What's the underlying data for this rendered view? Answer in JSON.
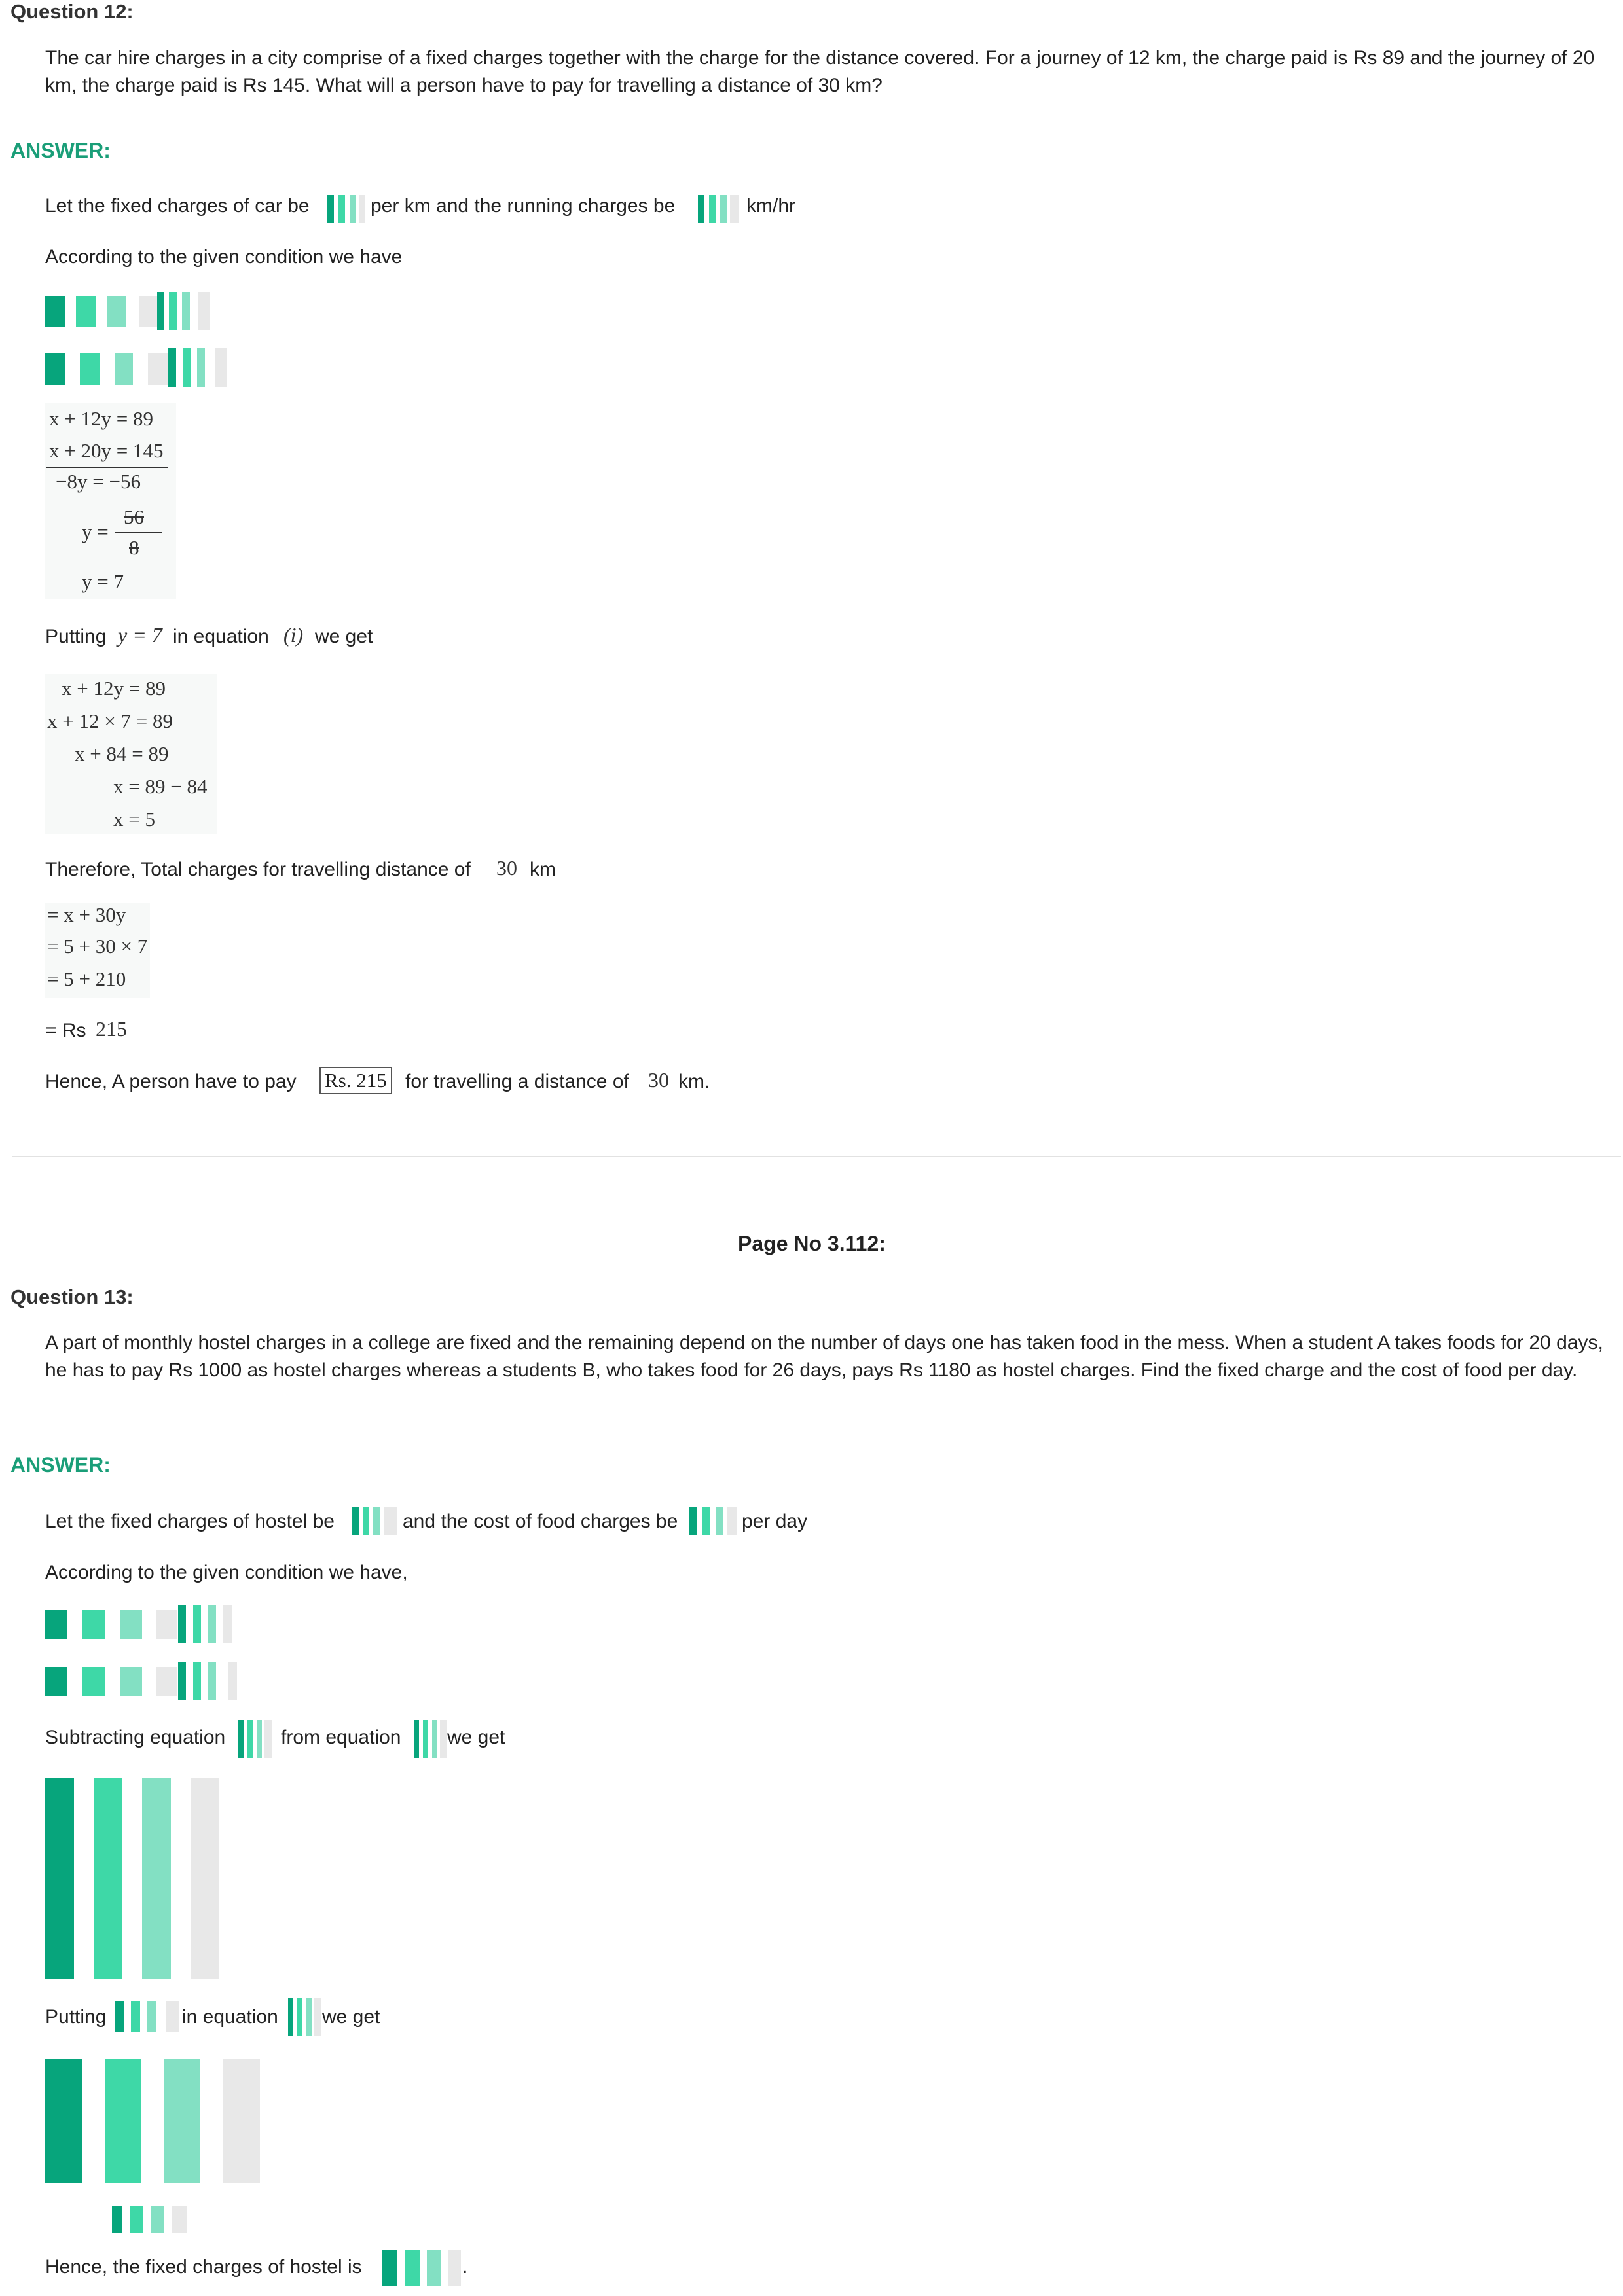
{
  "q12": {
    "title": "Question 12:",
    "text": "The car hire charges in a city comprise of a fixed charges together with the charge for the distance covered. For a journey of 12 km, the charge paid is Rs 89 and the journey of 20 km, the charge paid is Rs 145. What will a person have to pay for travelling a distance of 30 km?",
    "answer_label": "ANSWER:",
    "let_a": "Let the fixed charges of car be",
    "let_b": "per km and the running charges be",
    "let_c": "km/hr",
    "condition": "According to the given condition we have",
    "elim": [
      "x + 12y = 89",
      "x + 20y = 145",
      "−8y = −56",
      "y = ",
      "56",
      "8",
      "y = 7"
    ],
    "putting_a": "Putting",
    "putting_math": "y = 7",
    "putting_b": "in equation",
    "putting_eq": "(i)",
    "putting_c": "we get",
    "solve": [
      "x + 12y = 89",
      "x + 12 × 7 = 89",
      "x + 84 = 89",
      "x = 89 − 84",
      "x = 5"
    ],
    "total_a": "Therefore, Total charges for travelling distance of",
    "total_num": "30",
    "total_b": "km",
    "total_lines": [
      "= x + 30y",
      "= 5 + 30 × 7",
      "= 5 + 210"
    ],
    "rs_a": "= Rs",
    "rs_num": "215",
    "hence_a": "Hence, A person have to pay",
    "hence_box": "Rs. 215",
    "hence_b": "for travelling a distance of",
    "hence_num": "30",
    "hence_c": "km."
  },
  "page_no": "Page No 3.112:",
  "q13": {
    "title": "Question 13:",
    "text": "A part of monthly hostel charges in a college are fixed and the remaining depend on the number of days one has taken food in the mess. When a student A takes foods for 20 days, he has to pay Rs 1000 as hostel charges whereas a students B, who takes food for 26 days, pays Rs 1180 as hostel charges. Find the fixed charge and the cost of food per day.",
    "answer_label": "ANSWER:",
    "let_a": "Let the fixed charges of hostel be",
    "let_b": "and the cost of food charges be",
    "let_c": "per day",
    "condition": "According to the given condition we have,",
    "sub_a": "Subtracting equation",
    "sub_b": "from equation",
    "sub_c": "we get",
    "put_a": "Putting",
    "put_b": "in equation",
    "put_c": "we get",
    "hence": "Hence, the fixed charges of hostel is",
    "end": "."
  },
  "colors": {
    "accent": "#1a9e78",
    "placeholder_dark": "#07a57c",
    "placeholder_mid": "#3ed8a7",
    "placeholder_light": "#83e0c3",
    "placeholder_grey": "#e8e8e8"
  }
}
